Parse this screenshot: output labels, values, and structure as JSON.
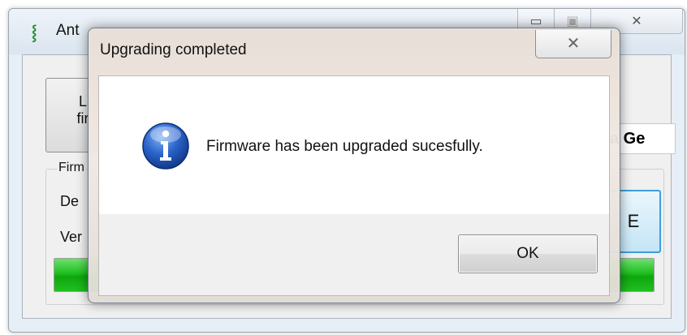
{
  "background_window": {
    "title": "Ant",
    "app_icon": "antenna-icon",
    "controls": {
      "minimize_icon": "minimize-icon",
      "maximize_icon": "maximize-icon",
      "close_icon": "close-icon"
    },
    "load_button_lines": [
      "L",
      "fir"
    ],
    "device_field_value": "a Ge",
    "group_label": "Firm",
    "rows": [
      "De",
      "Ver"
    ],
    "upgrade_button_label": "E",
    "progress_fraction": 1.0,
    "progress_color": "#1fbf1f"
  },
  "dialog": {
    "title": "Upgrading completed",
    "close_icon": "close-icon",
    "icon": "info-icon",
    "message": "Firmware has been upgraded sucesfully.",
    "ok_label": "OK"
  }
}
